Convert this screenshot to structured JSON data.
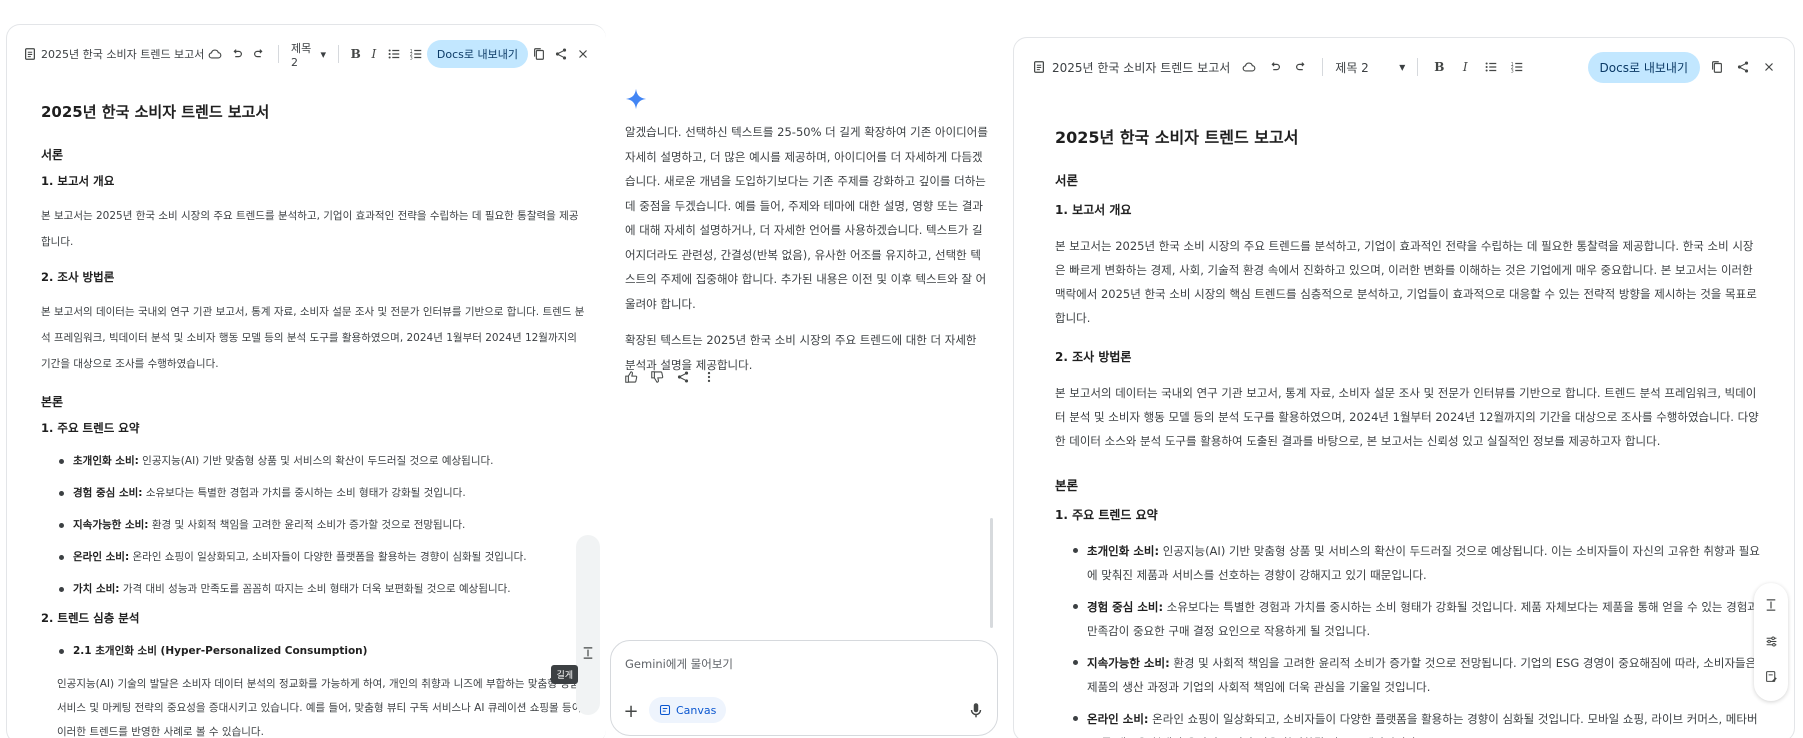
{
  "left_doc": {
    "toolbar": {
      "title": "2025년 한국 소비자 트렌드 보고서",
      "style_select": "제목 2",
      "export_label": "Docs로 내보내기"
    },
    "title": "2025년 한국 소비자 트렌드 보고서",
    "intro_heading": "서론",
    "s1_heading": "1. 보고서 개요",
    "s1_text": "본 보고서는 2025년 한국 소비 시장의 주요 트렌드를 분석하고, 기업이 효과적인 전략을 수립하는 데 필요한 통찰력을 제공합니다.",
    "s2_heading": "2. 조사 방법론",
    "s2_text": "본 보고서의 데이터는 국내외 연구 기관 보고서, 통계 자료, 소비자 설문 조사 및 전문가 인터뷰를 기반으로 합니다. 트렌드 분석 프레임워크, 빅데이터 분석 및 소비자 행동 모델 등의 분석 도구를 활용하였으며, 2024년 1월부터 2024년 12월까지의 기간을 대상으로 조사를 수행하였습니다.",
    "body_heading": "본론",
    "trends_heading": "1. 주요 트렌드 요약",
    "trends": [
      {
        "label": "초개인화 소비:",
        "text": " 인공지능(AI) 기반 맞춤형 상품 및 서비스의 확산이 두드러질 것으로 예상됩니다."
      },
      {
        "label": "경험 중심 소비:",
        "text": " 소유보다는 특별한 경험과 가치를 중시하는 소비 형태가 강화될 것입니다."
      },
      {
        "label": "지속가능한 소비:",
        "text": " 환경 및 사회적 책임을 고려한 윤리적 소비가 증가할 것으로 전망됩니다."
      },
      {
        "label": "온라인 소비:",
        "text": " 온라인 쇼핑이 일상화되고, 소비자들이 다양한 플랫폼을 활용하는 경향이 심화될 것입니다."
      },
      {
        "label": "가치 소비:",
        "text": " 가격 대비 성능과 만족도를 꼼꼼히 따지는 소비 형태가 더욱 보편화될 것으로 예상됩니다."
      }
    ],
    "deep_heading": "2. 트렌드 심층 분석",
    "deep_item": "2.1 초개인화 소비 (Hyper-Personalized Consumption)",
    "deep_text": "인공지능(AI) 기술의 발달은 소비자 데이터 분석의 정교화를 가능하게 하여, 개인의 취향과 니즈에 부합하는 맞춤형 상품, 서비스 및 마케팅 전략의 중요성을 증대시키고 있습니다. 예를 들어, 맞춤형 뷰티 구독 서비스나 AI 큐레이션 쇼핑몰 등이 이러한 트렌드를 반영한 사례로 볼 수 있습니다.",
    "tooltip": "길게"
  },
  "gemini": {
    "response_p1": "알겠습니다. 선택하신 텍스트를 25-50% 더 길게 확장하여 기존 아이디어를 자세히 설명하고, 더 많은 예시를 제공하며, 아이디어를 더 자세하게 다듬겠습니다. 새로운 개념을 도입하기보다는 기존 주제를 강화하고 깊이를 더하는 데 중점을 두겠습니다. 예를 들어, 주제와 테마에 대한 설명, 영향 또는 결과에 대해 자세히 설명하거나, 더 자세한 언어를 사용하겠습니다. 텍스트가 길어지더라도 관련성, 간결성(반복 없음), 유사한 어조를 유지하고, 선택한 텍스트의 주제에 집중해야 합니다. 추가된 내용은 이전 및 이후 텍스트와 잘 어울려야 합니다.",
    "response_p2": "확장된 텍스트는 2025년 한국 소비 시장의 주요 트렌드에 대한 더 자세한 분석과 설명을 제공합니다.",
    "input_placeholder": "Gemini에게 물어보기",
    "canvas_label": "Canvas"
  },
  "right_doc": {
    "toolbar": {
      "title": "2025년 한국 소비자 트렌드 보고서",
      "style_select": "제목 2",
      "export_label": "Docs로 내보내기"
    },
    "title": "2025년 한국 소비자 트렌드 보고서",
    "intro_heading": "서론",
    "s1_heading": "1. 보고서 개요",
    "s1_text": "본 보고서는 2025년 한국 소비 시장의 주요 트렌드를 분석하고, 기업이 효과적인 전략을 수립하는 데 필요한 통찰력을 제공합니다. 한국 소비 시장은 빠르게 변화하는 경제, 사회, 기술적 환경 속에서 진화하고 있으며, 이러한 변화를 이해하는 것은 기업에게 매우 중요합니다. 본 보고서는 이러한 맥락에서 2025년 한국 소비 시장의 핵심 트렌드를 심층적으로 분석하고, 기업들이 효과적으로 대응할 수 있는 전략적 방향을 제시하는 것을 목표로 합니다.",
    "s2_heading": "2. 조사 방법론",
    "s2_text": "본 보고서의 데이터는 국내외 연구 기관 보고서, 통계 자료, 소비자 설문 조사 및 전문가 인터뷰를 기반으로 합니다. 트렌드 분석 프레임워크, 빅데이터 분석 및 소비자 행동 모델 등의 분석 도구를 활용하였으며, 2024년 1월부터 2024년 12월까지의 기간을 대상으로 조사를 수행하였습니다. 다양한 데이터 소스와 분석 도구를 활용하여 도출된 결과를 바탕으로, 본 보고서는 신뢰성 있고 실질적인 정보를 제공하고자 합니다.",
    "body_heading": "본론",
    "trends_heading": "1. 주요 트렌드 요약",
    "trends": [
      {
        "label": "초개인화 소비:",
        "text": " 인공지능(AI) 기반 맞춤형 상품 및 서비스의 확산이 두드러질 것으로 예상됩니다. 이는 소비자들이 자신의 고유한 취향과 필요에 맞춰진 제품과 서비스를 선호하는 경향이 강해지고 있기 때문입니다."
      },
      {
        "label": "경험 중심 소비:",
        "text": " 소유보다는 특별한 경험과 가치를 중시하는 소비 형태가 강화될 것입니다. 제품 자체보다는 제품을 통해 얻을 수 있는 경험과 만족감이 중요한 구매 결정 요인으로 작용하게 될 것입니다."
      },
      {
        "label": "지속가능한 소비:",
        "text": " 환경 및 사회적 책임을 고려한 윤리적 소비가 증가할 것으로 전망됩니다. 기업의 ESG 경영이 중요해짐에 따라, 소비자들은 제품의 생산 과정과 기업의 사회적 책임에 더욱 관심을 기울일 것입니다."
      },
      {
        "label": "온라인 소비:",
        "text": " 온라인 쇼핑이 일상화되고, 소비자들이 다양한 플랫폼을 활용하는 경향이 심화될 것입니다. 모바일 쇼핑, 라이브 커머스, 메타버스 등 새로운 형태의 온라인 소비가 더욱 활성화될 것으로 예상됩니다."
      }
    ]
  }
}
